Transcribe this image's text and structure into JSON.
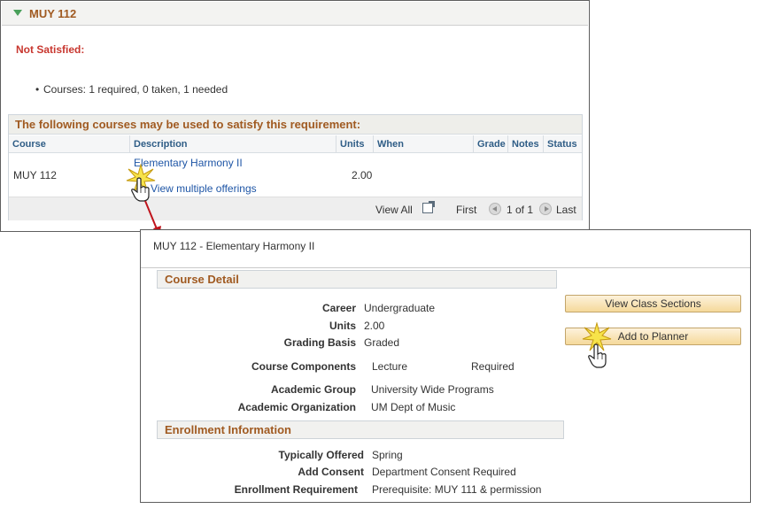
{
  "requirement": {
    "title": "MUY 112",
    "status": "Not Satisfied:",
    "courses_summary": "Courses:  1 required, 0 taken, 1 needed"
  },
  "grid": {
    "title": "The following courses may be used to satisfy this requirement:",
    "columns": [
      "Course",
      "Description",
      "Units",
      "When",
      "Grade",
      "Notes",
      "Status"
    ],
    "rows": [
      {
        "course": "MUY 112",
        "description": "Elementary Harmony II",
        "units": "2.00",
        "extra_link": "View multiple offerings"
      }
    ],
    "footer": {
      "view_all": "View All",
      "first": "First",
      "page": "1 of 1",
      "last": "Last"
    }
  },
  "detail": {
    "title": "MUY  112 - Elementary Harmony II",
    "course_detail": {
      "heading": "Course Detail",
      "fields": [
        {
          "label": "Career",
          "value": "Undergraduate"
        },
        {
          "label": "Units",
          "value": "2.00"
        },
        {
          "label": "Grading Basis",
          "value": "Graded"
        },
        {
          "label": "Course Components",
          "value": "Lecture",
          "extra": "Required"
        },
        {
          "label": "Academic Group",
          "value": "University Wide Programs"
        },
        {
          "label": "Academic Organization",
          "value": "UM Dept of Music"
        }
      ]
    },
    "enrollment": {
      "heading": "Enrollment Information",
      "fields": [
        {
          "label": "Typically Offered",
          "value": "Spring"
        },
        {
          "label": "Add Consent",
          "value": "Department Consent Required"
        },
        {
          "label": "Enrollment Requirement",
          "value": "Prerequisite: MUY 111 & permission"
        }
      ]
    },
    "buttons": {
      "view_class_sections": "View Class Sections",
      "add_to_planner": "Add to Planner"
    }
  },
  "colors": {
    "header_text": "#a05a21",
    "status_red": "#c8372f",
    "link_blue": "#1f56a6",
    "column_header": "#2f5d86",
    "arrow_red": "#c0141c",
    "button_fill": "#f5d99a"
  },
  "icons": [
    "collapse-triangle-icon",
    "view-all-icon",
    "previous-page-icon",
    "next-page-icon",
    "hand-cursor-icon",
    "click-burst-icon",
    "callout-arrow-icon"
  ]
}
